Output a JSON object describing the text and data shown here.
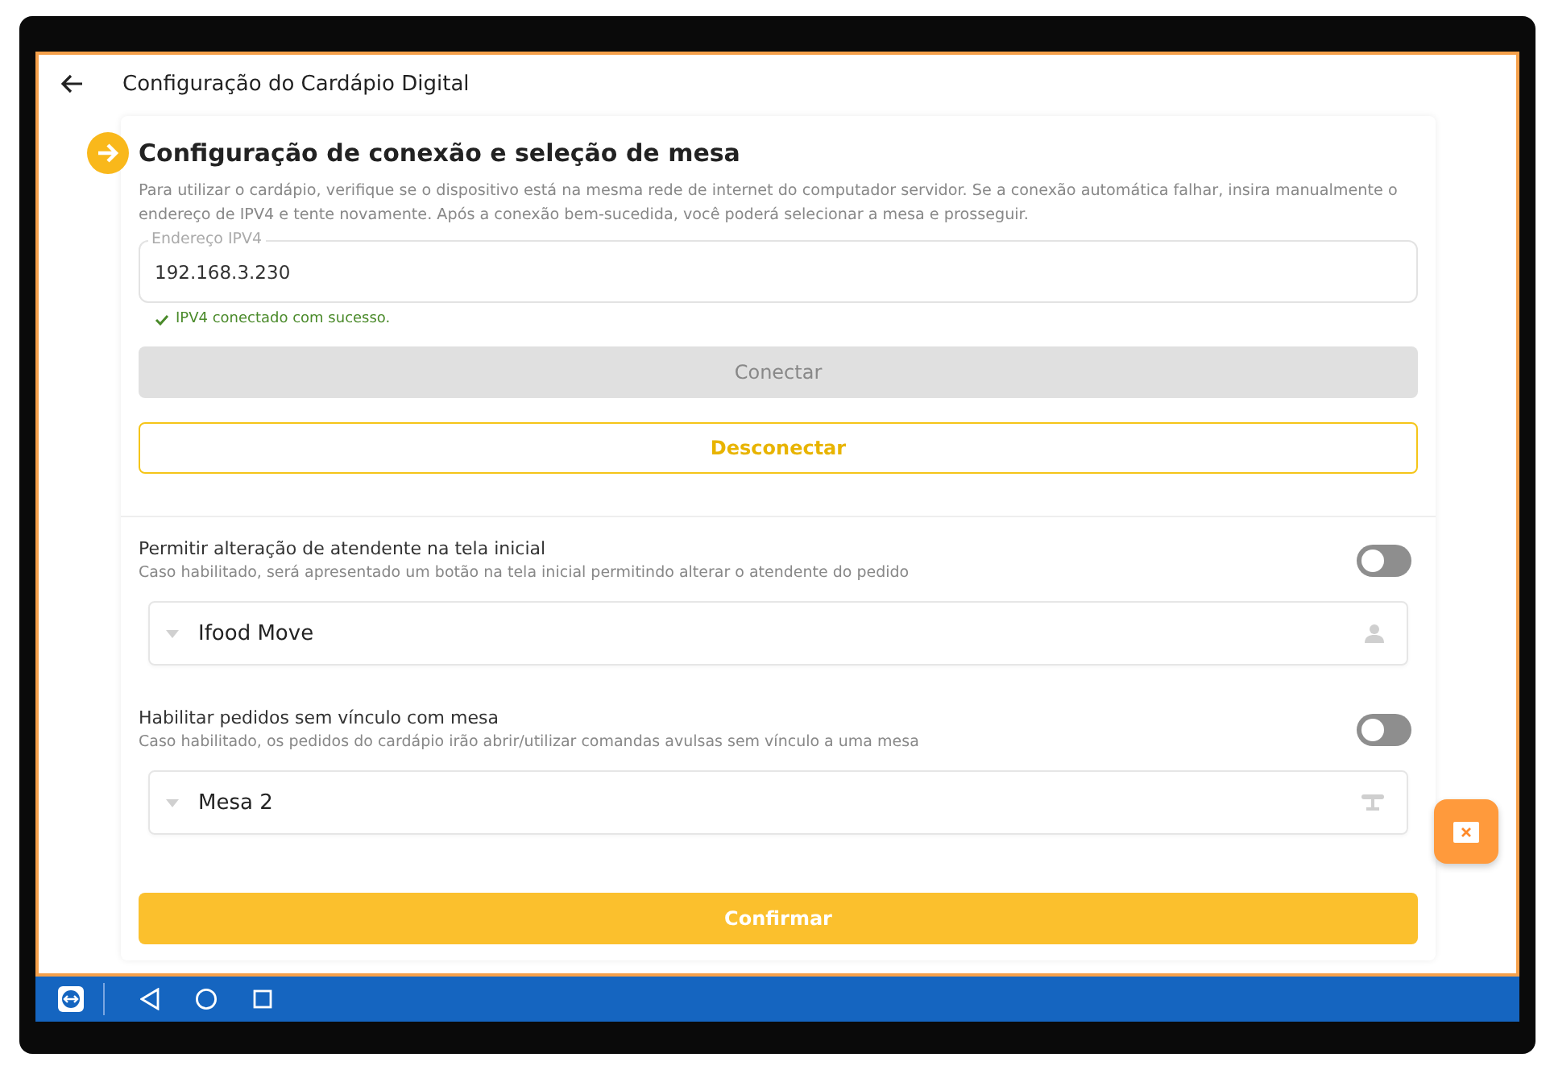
{
  "header": {
    "title": "Configuração do Cardápio Digital"
  },
  "section": {
    "title": "Configuração de conexão e seleção de mesa",
    "description": "Para utilizar o cardápio, verifique se o dispositivo está na mesma rede de internet do computador servidor. Se a conexão automática falhar, insira manualmente o endereço de IPV4 e tente novamente. Após a conexão bem-sucedida, você poderá selecionar a mesa e prosseguir."
  },
  "ipv4_field": {
    "label": "Endereço IPV4",
    "value": "192.168.3.230"
  },
  "status_message": "IPV4 conectado com sucesso.",
  "connect_button": {
    "label": "Conectar",
    "disabled": true
  },
  "disconnect_button": {
    "label": "Desconectar"
  },
  "settings": [
    {
      "title": "Permitir alteração de atendente na tela inicial",
      "description": "Caso habilitado, será apresentado um botão na tela inicial permitindo alterar o atendente do pedido",
      "on": false,
      "select": {
        "value": "Ifood Move"
      }
    },
    {
      "title": "Habilitar pedidos sem vínculo com mesa",
      "description": "Caso habilitado, os pedidos do cardápio irão abrir/utilizar comandas avulsas sem vínculo a uma mesa",
      "on": false,
      "select": {
        "value": "Mesa 2"
      }
    }
  ],
  "confirm_button": {
    "label": "Confirmar"
  }
}
